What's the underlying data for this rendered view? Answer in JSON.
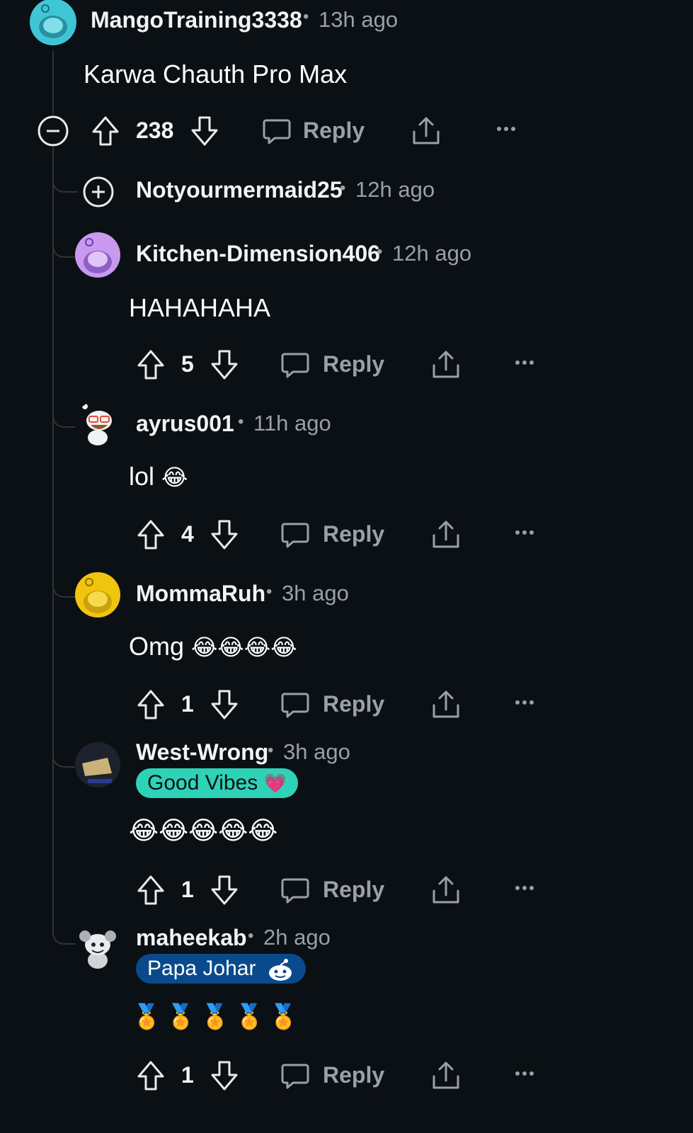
{
  "comments": [
    {
      "username": "MangoTraining3338",
      "sep": "•",
      "time": "13h ago",
      "body": "Karwa Chauth Pro Max",
      "score": "238",
      "reply_label": "Reply"
    },
    {
      "username": "Notyourmermaid25",
      "sep": "•",
      "time": "12h ago",
      "collapsed": true
    },
    {
      "username": "Kitchen-Dimension406",
      "sep": "•",
      "time": "12h ago",
      "body": "HAHAHAHA",
      "score": "5",
      "reply_label": "Reply"
    },
    {
      "username": "ayrus001",
      "sep": "•",
      "time": "11h ago",
      "body": "lol",
      "emoji": "😂",
      "score": "4",
      "reply_label": "Reply"
    },
    {
      "username": "MommaRuh",
      "sep": "•",
      "time": "3h ago",
      "body": "Omg",
      "emoji": "😂😂😂😂",
      "score": "1",
      "reply_label": "Reply"
    },
    {
      "username": "West-Wrong",
      "sep": "•",
      "time": "3h ago",
      "flair": "Good Vibes",
      "flair_emoji": "💗",
      "body": "😂😂😂😂😂",
      "score": "1",
      "reply_label": "Reply"
    },
    {
      "username": "maheekab",
      "sep": "•",
      "time": "2h ago",
      "flair": "Papa Johar",
      "body": "🏅🏅🏅🏅🏅",
      "score": "1",
      "reply_label": "Reply"
    }
  ],
  "colors": {
    "background": "#0b1014",
    "good_vibes_flair": "#2ed3b7",
    "papa_johar_flair": "#0a4a8c",
    "avatar_teal": "#3fc6d6",
    "avatar_purple": "#c79af0",
    "avatar_yellow": "#f1c40f"
  },
  "icons": [
    "collapse-icon",
    "expand-icon",
    "upvote-icon",
    "downvote-icon",
    "comment-icon",
    "share-icon",
    "more-icon"
  ]
}
